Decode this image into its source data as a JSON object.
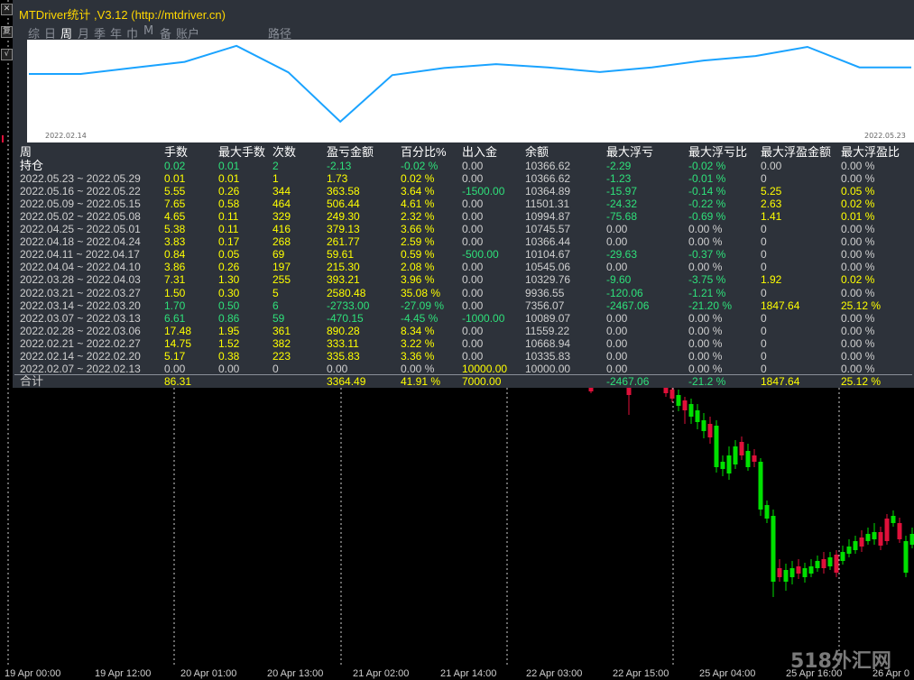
{
  "title": "MTDriver统计 ,V3.12 (http://mtdriver.cn)",
  "tabs": [
    "综",
    "日",
    "周",
    "月",
    "季",
    "年",
    "巾",
    "M",
    "备",
    "账户",
    "路径"
  ],
  "active_tab": "周",
  "left_buttons": [
    "✕",
    "复",
    "√"
  ],
  "line_chart": {
    "start_label": "2022.02.14",
    "end_label": "2022.05.23",
    "values": [
      10000,
      10000,
      10335.83,
      10668.94,
      11559.22,
      10089.07,
      7356.07,
      9936.55,
      10329.76,
      10545.06,
      10366.44,
      10104.67,
      10366.44,
      10745.57,
      10994.87,
      11501.31,
      10364.89,
      10366.62
    ],
    "line_color": "#1aa3ff"
  },
  "headers": [
    "周",
    "手数",
    "最大手数",
    "次数",
    "盈亏金额",
    "百分比%",
    "出入金",
    "余额",
    "最大浮亏",
    "最大浮亏比",
    "最大浮盈金额",
    "最大浮盈比"
  ],
  "rows": [
    {
      "label": "持仓",
      "lots": "0.02",
      "max_lots": "0.01",
      "count": "2",
      "pnl": "-2.13",
      "pct": "-0.02 %",
      "flow": "0.00",
      "balance": "10366.62",
      "max_dd": "-2.29",
      "max_dd_pct": "-0.02 %",
      "max_fp": "0.00",
      "max_fp_pct": "0.00 %",
      "lot_color": "#2ee07a",
      "pnl_color": "#2ee07a",
      "flow_color": "#cfcfcf",
      "dd_color": "#2ee07a",
      "fp_color": "#cfcfcf"
    },
    {
      "label": "2022.05.23 ~ 2022.05.29",
      "lots": "0.01",
      "max_lots": "0.01",
      "count": "1",
      "pnl": "1.73",
      "pct": "0.02 %",
      "flow": "0.00",
      "balance": "10366.62",
      "max_dd": "-1.23",
      "max_dd_pct": "-0.01 %",
      "max_fp": "0",
      "max_fp_pct": "0.00 %",
      "lot_color": "#ffff00",
      "pnl_color": "#ffff00",
      "flow_color": "#cfcfcf",
      "dd_color": "#2ee07a",
      "fp_color": "#cfcfcf"
    },
    {
      "label": "2022.05.16 ~ 2022.05.22",
      "lots": "5.55",
      "max_lots": "0.26",
      "count": "344",
      "pnl": "363.58",
      "pct": "3.64 %",
      "flow": "-1500.00",
      "balance": "10364.89",
      "max_dd": "-15.97",
      "max_dd_pct": "-0.14 %",
      "max_fp": "5.25",
      "max_fp_pct": "0.05 %",
      "lot_color": "#ffff00",
      "pnl_color": "#ffff00",
      "flow_color": "#2ee07a",
      "dd_color": "#2ee07a",
      "fp_color": "#ffff00"
    },
    {
      "label": "2022.05.09 ~ 2022.05.15",
      "lots": "7.65",
      "max_lots": "0.58",
      "count": "464",
      "pnl": "506.44",
      "pct": "4.61 %",
      "flow": "0.00",
      "balance": "11501.31",
      "max_dd": "-24.32",
      "max_dd_pct": "-0.22 %",
      "max_fp": "2.63",
      "max_fp_pct": "0.02 %",
      "lot_color": "#ffff00",
      "pnl_color": "#ffff00",
      "flow_color": "#cfcfcf",
      "dd_color": "#2ee07a",
      "fp_color": "#ffff00"
    },
    {
      "label": "2022.05.02 ~ 2022.05.08",
      "lots": "4.65",
      "max_lots": "0.11",
      "count": "329",
      "pnl": "249.30",
      "pct": "2.32 %",
      "flow": "0.00",
      "balance": "10994.87",
      "max_dd": "-75.68",
      "max_dd_pct": "-0.69 %",
      "max_fp": "1.41",
      "max_fp_pct": "0.01 %",
      "lot_color": "#ffff00",
      "pnl_color": "#ffff00",
      "flow_color": "#cfcfcf",
      "dd_color": "#2ee07a",
      "fp_color": "#ffff00"
    },
    {
      "label": "2022.04.25 ~ 2022.05.01",
      "lots": "5.38",
      "max_lots": "0.11",
      "count": "416",
      "pnl": "379.13",
      "pct": "3.66 %",
      "flow": "0.00",
      "balance": "10745.57",
      "max_dd": "0.00",
      "max_dd_pct": "0.00 %",
      "max_fp": "0",
      "max_fp_pct": "0.00 %",
      "lot_color": "#ffff00",
      "pnl_color": "#ffff00",
      "flow_color": "#cfcfcf",
      "dd_color": "#cfcfcf",
      "fp_color": "#cfcfcf"
    },
    {
      "label": "2022.04.18 ~ 2022.04.24",
      "lots": "3.83",
      "max_lots": "0.17",
      "count": "268",
      "pnl": "261.77",
      "pct": "2.59 %",
      "flow": "0.00",
      "balance": "10366.44",
      "max_dd": "0.00",
      "max_dd_pct": "0.00 %",
      "max_fp": "0",
      "max_fp_pct": "0.00 %",
      "lot_color": "#ffff00",
      "pnl_color": "#ffff00",
      "flow_color": "#cfcfcf",
      "dd_color": "#cfcfcf",
      "fp_color": "#cfcfcf"
    },
    {
      "label": "2022.04.11 ~ 2022.04.17",
      "lots": "0.84",
      "max_lots": "0.05",
      "count": "69",
      "pnl": "59.61",
      "pct": "0.59 %",
      "flow": "-500.00",
      "balance": "10104.67",
      "max_dd": "-29.63",
      "max_dd_pct": "-0.37 %",
      "max_fp": "0",
      "max_fp_pct": "0.00 %",
      "lot_color": "#ffff00",
      "pnl_color": "#ffff00",
      "flow_color": "#2ee07a",
      "dd_color": "#2ee07a",
      "fp_color": "#cfcfcf"
    },
    {
      "label": "2022.04.04 ~ 2022.04.10",
      "lots": "3.86",
      "max_lots": "0.26",
      "count": "197",
      "pnl": "215.30",
      "pct": "2.08 %",
      "flow": "0.00",
      "balance": "10545.06",
      "max_dd": "0.00",
      "max_dd_pct": "0.00 %",
      "max_fp": "0",
      "max_fp_pct": "0.00 %",
      "lot_color": "#ffff00",
      "pnl_color": "#ffff00",
      "flow_color": "#cfcfcf",
      "dd_color": "#cfcfcf",
      "fp_color": "#cfcfcf"
    },
    {
      "label": "2022.03.28 ~ 2022.04.03",
      "lots": "7.31",
      "max_lots": "1.30",
      "count": "255",
      "pnl": "393.21",
      "pct": "3.96 %",
      "flow": "0.00",
      "balance": "10329.76",
      "max_dd": "-9.60",
      "max_dd_pct": "-3.75 %",
      "max_fp": "1.92",
      "max_fp_pct": "0.02 %",
      "lot_color": "#ffff00",
      "pnl_color": "#ffff00",
      "flow_color": "#cfcfcf",
      "dd_color": "#2ee07a",
      "fp_color": "#ffff00"
    },
    {
      "label": "2022.03.21 ~ 2022.03.27",
      "lots": "1.50",
      "max_lots": "0.30",
      "count": "5",
      "pnl": "2580.48",
      "pct": "35.08 %",
      "flow": "0.00",
      "balance": "9936.55",
      "max_dd": "-120.06",
      "max_dd_pct": "-1.21 %",
      "max_fp": "0",
      "max_fp_pct": "0.00 %",
      "lot_color": "#ffff00",
      "pnl_color": "#ffff00",
      "flow_color": "#cfcfcf",
      "dd_color": "#2ee07a",
      "fp_color": "#cfcfcf"
    },
    {
      "label": "2022.03.14 ~ 2022.03.20",
      "lots": "1.70",
      "max_lots": "0.50",
      "count": "6",
      "pnl": "-2733.00",
      "pct": "-27.09 %",
      "flow": "0.00",
      "balance": "7356.07",
      "max_dd": "-2467.06",
      "max_dd_pct": "-21.20 %",
      "max_fp": "1847.64",
      "max_fp_pct": "25.12 %",
      "lot_color": "#2ee07a",
      "pnl_color": "#2ee07a",
      "flow_color": "#cfcfcf",
      "dd_color": "#2ee07a",
      "fp_color": "#ffff00"
    },
    {
      "label": "2022.03.07 ~ 2022.03.13",
      "lots": "6.61",
      "max_lots": "0.86",
      "count": "59",
      "pnl": "-470.15",
      "pct": "-4.45 %",
      "flow": "-1000.00",
      "balance": "10089.07",
      "max_dd": "0.00",
      "max_dd_pct": "0.00 %",
      "max_fp": "0",
      "max_fp_pct": "0.00 %",
      "lot_color": "#2ee07a",
      "pnl_color": "#2ee07a",
      "flow_color": "#2ee07a",
      "dd_color": "#cfcfcf",
      "fp_color": "#cfcfcf"
    },
    {
      "label": "2022.02.28 ~ 2022.03.06",
      "lots": "17.48",
      "max_lots": "1.95",
      "count": "361",
      "pnl": "890.28",
      "pct": "8.34 %",
      "flow": "0.00",
      "balance": "11559.22",
      "max_dd": "0.00",
      "max_dd_pct": "0.00 %",
      "max_fp": "0",
      "max_fp_pct": "0.00 %",
      "lot_color": "#ffff00",
      "pnl_color": "#ffff00",
      "flow_color": "#cfcfcf",
      "dd_color": "#cfcfcf",
      "fp_color": "#cfcfcf"
    },
    {
      "label": "2022.02.21 ~ 2022.02.27",
      "lots": "14.75",
      "max_lots": "1.52",
      "count": "382",
      "pnl": "333.11",
      "pct": "3.22 %",
      "flow": "0.00",
      "balance": "10668.94",
      "max_dd": "0.00",
      "max_dd_pct": "0.00 %",
      "max_fp": "0",
      "max_fp_pct": "0.00 %",
      "lot_color": "#ffff00",
      "pnl_color": "#ffff00",
      "flow_color": "#cfcfcf",
      "dd_color": "#cfcfcf",
      "fp_color": "#cfcfcf"
    },
    {
      "label": "2022.02.14 ~ 2022.02.20",
      "lots": "5.17",
      "max_lots": "0.38",
      "count": "223",
      "pnl": "335.83",
      "pct": "3.36 %",
      "flow": "0.00",
      "balance": "10335.83",
      "max_dd": "0.00",
      "max_dd_pct": "0.00 %",
      "max_fp": "0",
      "max_fp_pct": "0.00 %",
      "lot_color": "#ffff00",
      "pnl_color": "#ffff00",
      "flow_color": "#cfcfcf",
      "dd_color": "#cfcfcf",
      "fp_color": "#cfcfcf"
    },
    {
      "label": "2022.02.07 ~ 2022.02.13",
      "lots": "0.00",
      "max_lots": "0.00",
      "count": "0",
      "pnl": "0.00",
      "pct": "0.00 %",
      "flow": "10000.00",
      "balance": "10000.00",
      "max_dd": "0.00",
      "max_dd_pct": "0.00 %",
      "max_fp": "0",
      "max_fp_pct": "0.00 %",
      "lot_color": "#cfcfcf",
      "pnl_color": "#cfcfcf",
      "flow_color": "#ffff00",
      "dd_color": "#cfcfcf",
      "fp_color": "#cfcfcf"
    }
  ],
  "totals": {
    "label": "合计",
    "lots": "86.31",
    "pnl": "3364.49",
    "pct": "41.91 %",
    "flow": "7000.00",
    "max_dd": "-2467.06",
    "max_dd_pct": "-21.2 %",
    "max_fp": "1847.64",
    "max_fp_pct": "25.12 %"
  },
  "time_axis": [
    "19 Apr 00:00",
    "19 Apr 12:00",
    "20 Apr 01:00",
    "20 Apr 13:00",
    "21 Apr 02:00",
    "21 Apr 14:00",
    "22 Apr 03:00",
    "22 Apr 15:00",
    "25 Apr 04:00",
    "25 Apr 16:00",
    "26 Apr 0"
  ],
  "watermark": "518外汇网",
  "colors": {
    "panel_bg": "#2d323a",
    "bull": "#00e000",
    "bear": "#e0103a",
    "title": "#ffd700"
  }
}
